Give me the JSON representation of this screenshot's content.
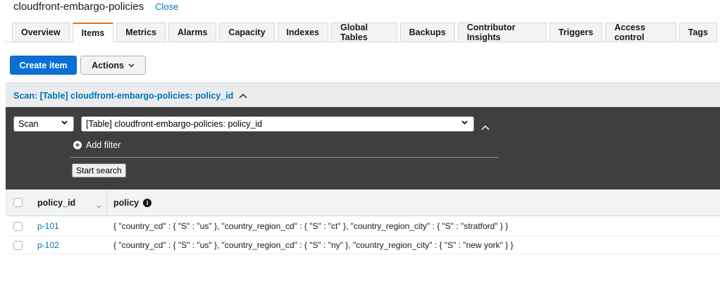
{
  "header": {
    "title": "cloudfront-embargo-policies",
    "close_label": "Close"
  },
  "tabs": [
    {
      "label": "Overview",
      "active": false
    },
    {
      "label": "Items",
      "active": true
    },
    {
      "label": "Metrics",
      "active": false
    },
    {
      "label": "Alarms",
      "active": false
    },
    {
      "label": "Capacity",
      "active": false
    },
    {
      "label": "Indexes",
      "active": false
    },
    {
      "label": "Global Tables",
      "active": false
    },
    {
      "label": "Backups",
      "active": false
    },
    {
      "label": "Contributor Insights",
      "active": false
    },
    {
      "label": "Triggers",
      "active": false
    },
    {
      "label": "Access control",
      "active": false
    },
    {
      "label": "Tags",
      "active": false
    }
  ],
  "toolbar": {
    "create_item_label": "Create item",
    "actions_label": "Actions"
  },
  "scan": {
    "summary": "Scan: [Table] cloudfront-embargo-policies: policy_id",
    "operation_value": "Scan",
    "target_value": "[Table] cloudfront-embargo-policies: policy_id",
    "add_filter_label": "Add filter",
    "start_search_label": "Start search"
  },
  "table": {
    "columns": [
      "policy_id",
      "policy"
    ],
    "rows": [
      {
        "policy_id": "p-101",
        "policy": "{ \"country_cd\" : { \"S\" : \"us\" }, \"country_region_cd\" : { \"S\" : \"ct\" }, \"country_region_city\" : { \"S\" : \"stratford\" } }"
      },
      {
        "policy_id": "p-102",
        "policy": "{ \"country_cd\" : { \"S\" : \"us\" }, \"country_region_cd\" : { \"S\" : \"ny\" }, \"country_region_city\" : { \"S\" : \"new york\" } }"
      }
    ]
  },
  "colors": {
    "accent": "#ec7211",
    "link": "#0073bb",
    "primary_button": "#0a70d4",
    "panel_dark": "#3f3f3f"
  }
}
